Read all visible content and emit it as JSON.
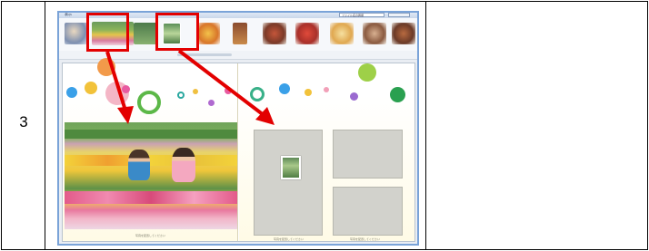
{
  "table": {
    "step_number": "3"
  },
  "app": {
    "menu_label": "表示",
    "sort_select_value": "ファイル名の昇順",
    "photo_caption": "写真を配置してください",
    "right_caption_left": "写真を配置してください",
    "right_caption_right": "写真を配置してください"
  },
  "thumbnails": [
    {
      "name": "kids-flowers",
      "color": "#7aa84f"
    },
    {
      "name": "portrait",
      "color": "#8aa2c8"
    },
    {
      "name": "outdoor",
      "color": "#5c8a5a"
    },
    {
      "name": "food-1",
      "color": "#d68a3a"
    },
    {
      "name": "food-2",
      "color": "#b5653a"
    },
    {
      "name": "food-3",
      "color": "#9b4b3a"
    },
    {
      "name": "food-4",
      "color": "#c43a2a"
    },
    {
      "name": "food-5",
      "color": "#e0b060"
    },
    {
      "name": "food-6",
      "color": "#b8785a"
    },
    {
      "name": "food-7",
      "color": "#a0553a"
    }
  ],
  "colors": {
    "highlight": "#e30000",
    "window_border": "#7aa3d8",
    "slot": "#d2d2cc"
  },
  "icons": [
    "red-arrow-icon",
    "red-arrow-icon"
  ]
}
